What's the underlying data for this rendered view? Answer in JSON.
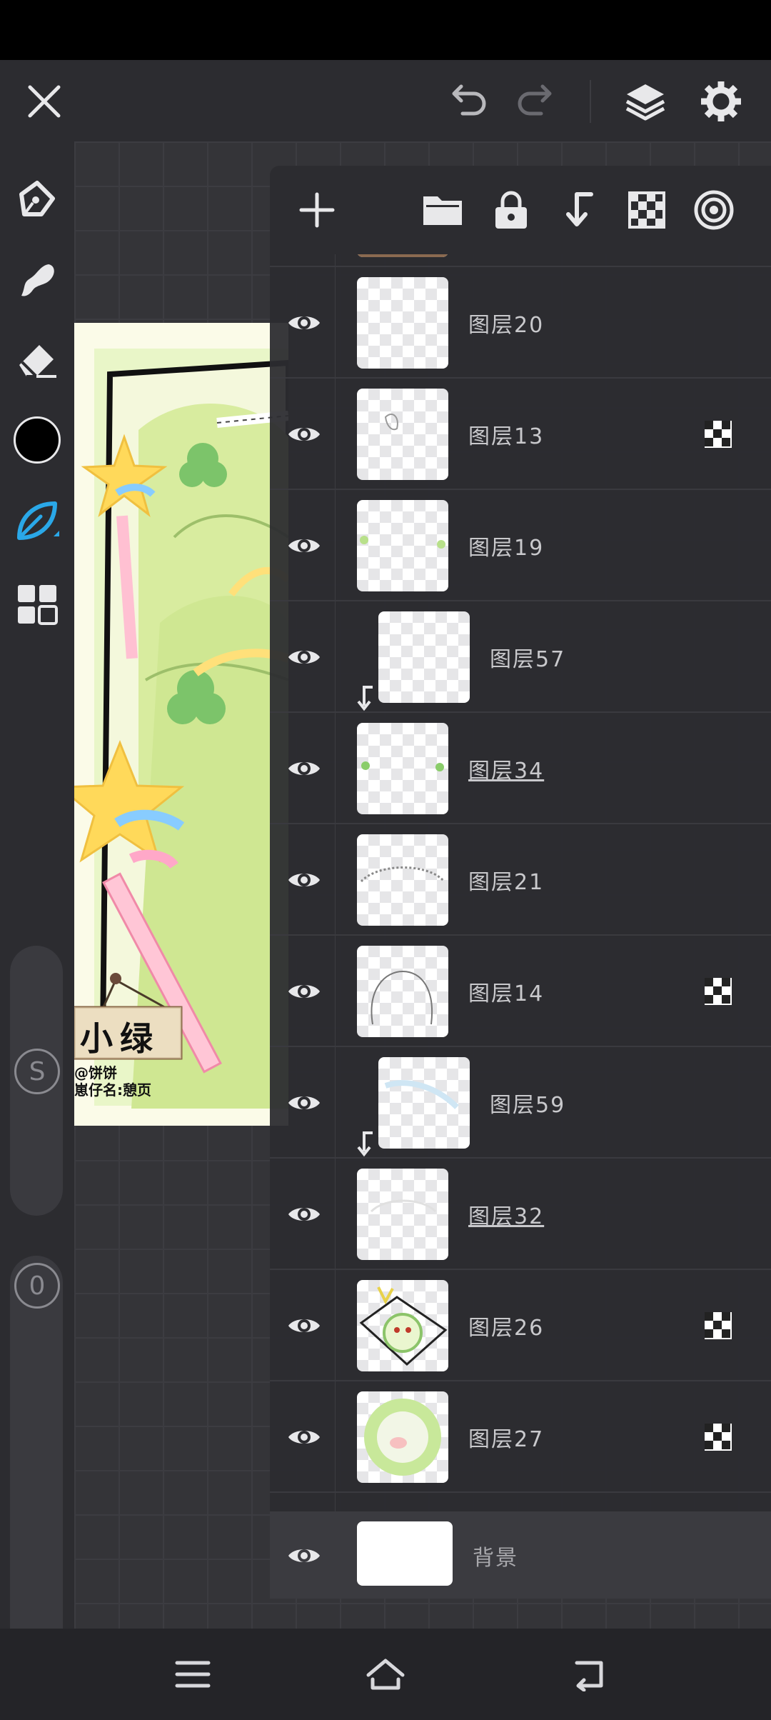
{
  "app": {
    "colors": {
      "accent": "#2aa8e8",
      "icon": "#e8e8ea",
      "icon_dim": "#8a8a90",
      "panel": "#2c2c30",
      "current_color": "#000000"
    }
  },
  "topbar": {
    "close_icon": "close-icon",
    "undo_icon": "undo-icon",
    "redo_icon": "redo-icon",
    "layers_icon": "layers-icon",
    "settings_icon": "gear-icon"
  },
  "toolbar": {
    "tools": [
      "pen-icon",
      "smudge-icon",
      "eraser-icon",
      "color-swatch",
      "leaf-brush-icon",
      "grid-menu-icon"
    ],
    "size_slider_label": "S",
    "opacity_slider_label": "0"
  },
  "artwork": {
    "sign_text": "小绿",
    "credit_line1": "@饼饼",
    "credit_line2": "崽仔名:憩页"
  },
  "layer_panel": {
    "header_icons": [
      "add-icon",
      "folder-icon",
      "lock-icon",
      "merge-down-icon",
      "alpha-lock-icon",
      "target-icon"
    ],
    "layers": [
      {
        "name": "图层20",
        "clipped": false,
        "alpha_lock": false,
        "underline": false
      },
      {
        "name": "图层13",
        "clipped": false,
        "alpha_lock": true,
        "underline": false
      },
      {
        "name": "图层19",
        "clipped": false,
        "alpha_lock": false,
        "underline": false
      },
      {
        "name": "图层57",
        "clipped": true,
        "alpha_lock": false,
        "underline": false
      },
      {
        "name": "图层34",
        "clipped": false,
        "alpha_lock": false,
        "underline": true
      },
      {
        "name": "图层21",
        "clipped": false,
        "alpha_lock": false,
        "underline": false
      },
      {
        "name": "图层14",
        "clipped": false,
        "alpha_lock": true,
        "underline": false
      },
      {
        "name": "图层59",
        "clipped": true,
        "alpha_lock": false,
        "underline": false
      },
      {
        "name": "图层32",
        "clipped": false,
        "alpha_lock": false,
        "underline": true
      },
      {
        "name": "图层26",
        "clipped": false,
        "alpha_lock": true,
        "underline": false
      },
      {
        "name": "图层27",
        "clipped": false,
        "alpha_lock": true,
        "underline": false
      }
    ],
    "background_layer": "背景"
  },
  "navbar": {
    "icons": [
      "menu-icon",
      "home-icon",
      "back-icon"
    ]
  }
}
